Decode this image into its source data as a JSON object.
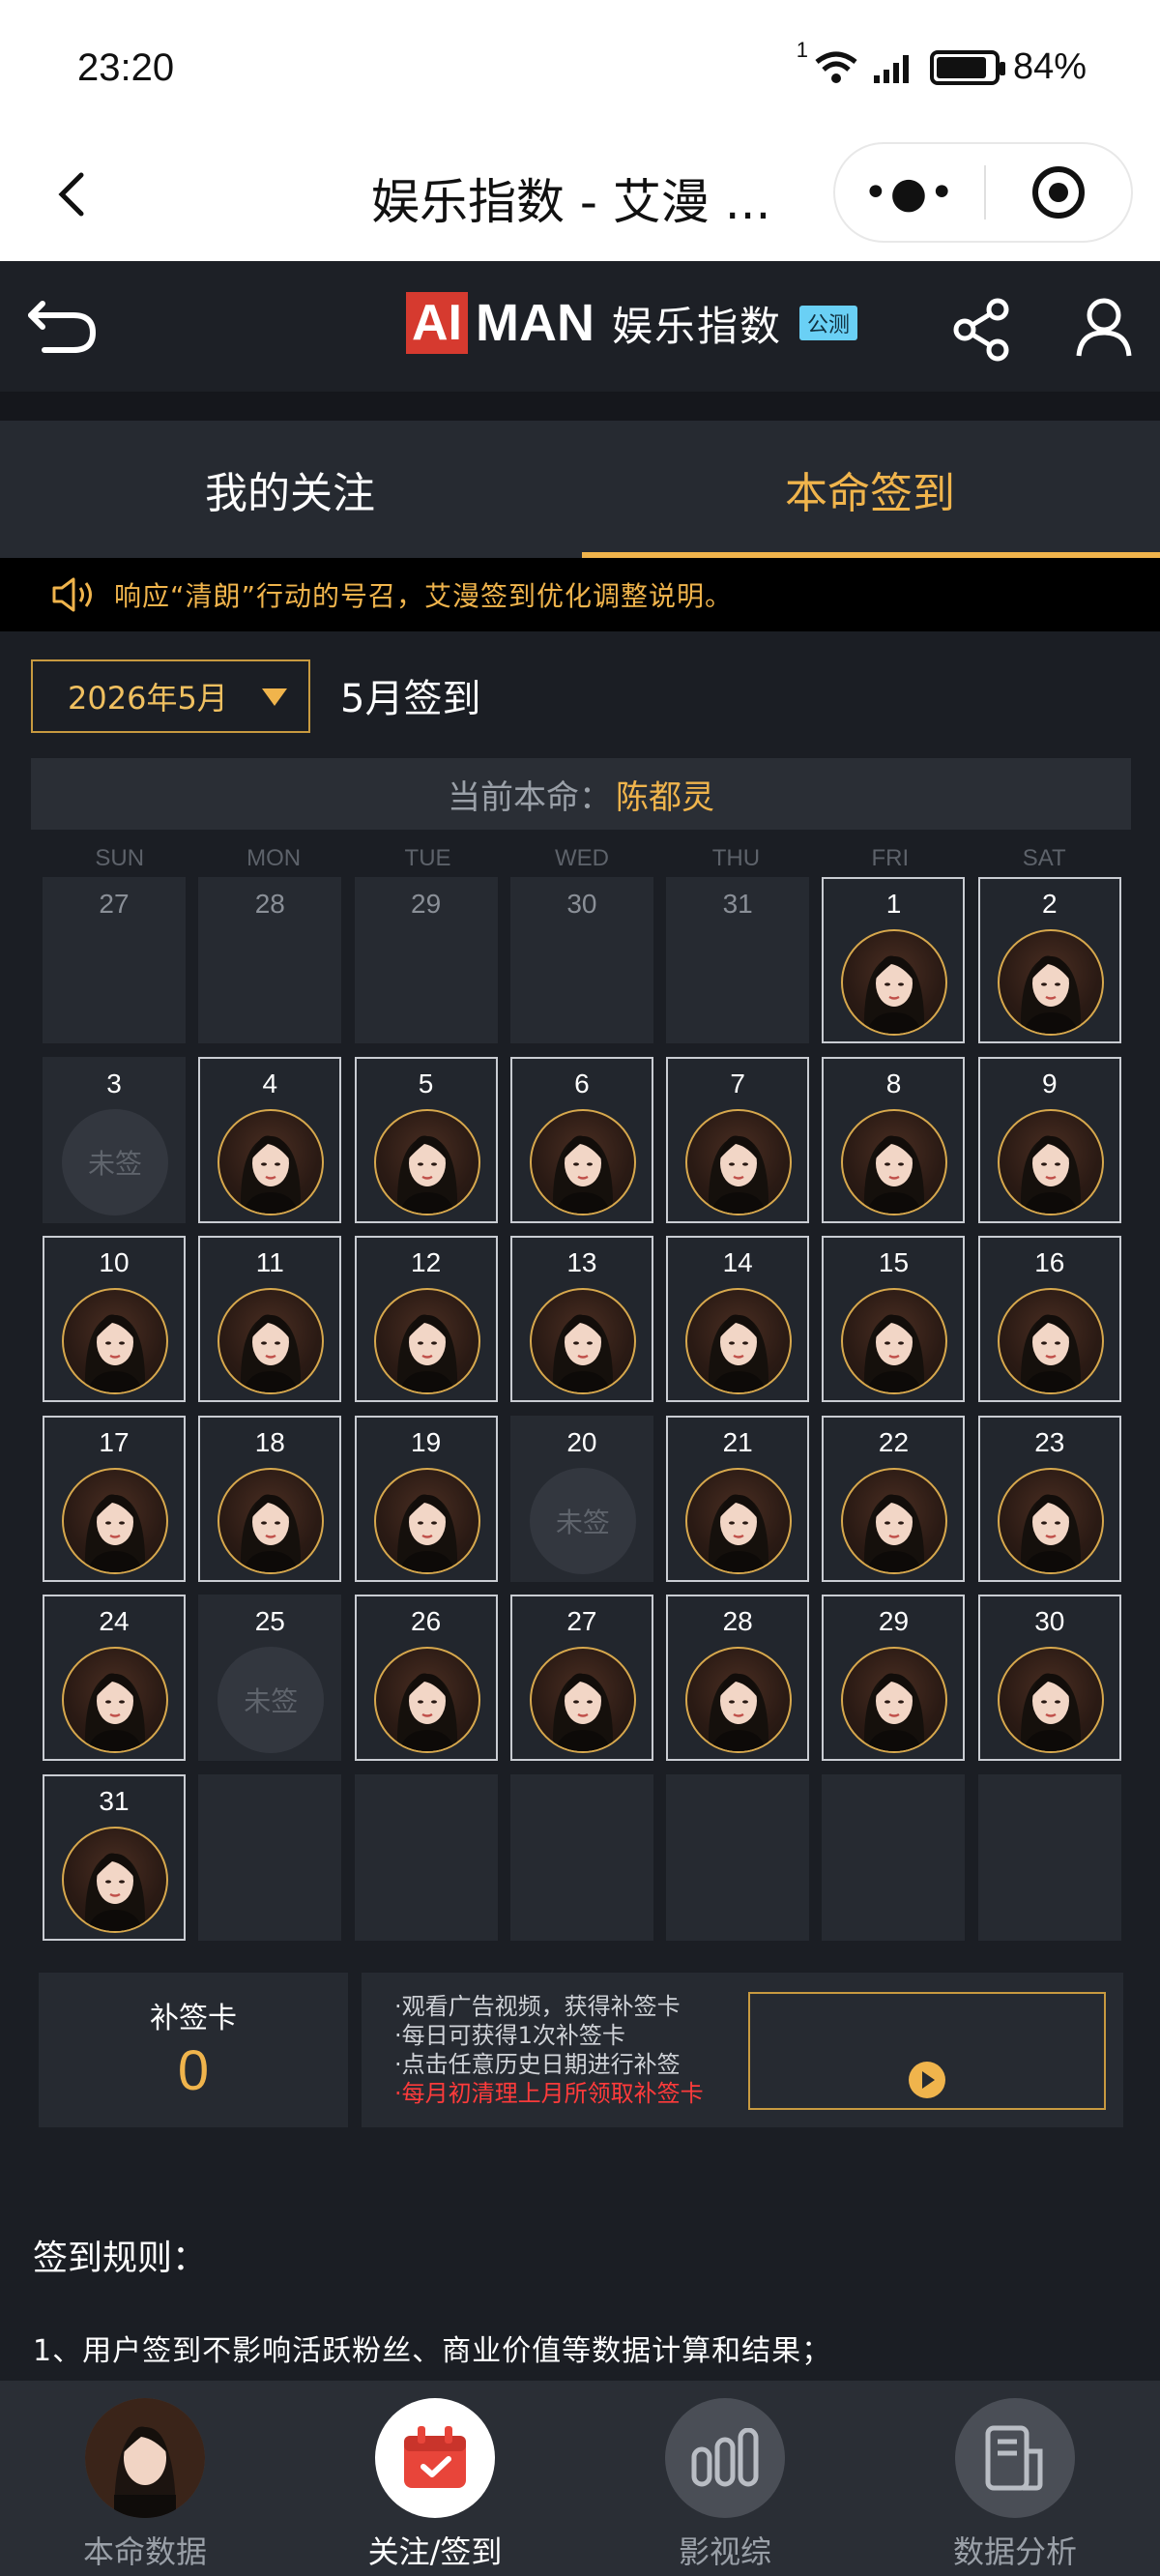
{
  "status_bar": {
    "time": "23:20",
    "wifi_badge": "1",
    "battery": "84%"
  },
  "title_bar": {
    "title": "娱乐指数 - 艾漫 ..."
  },
  "app_header": {
    "brand_ai": "AI",
    "brand_man": "MAN",
    "brand_cn": "娱乐指数",
    "brand_badge": "公测"
  },
  "tabs": [
    {
      "label": "我的关注",
      "active": false
    },
    {
      "label": "本命签到",
      "active": true
    }
  ],
  "notice": {
    "text": "响应“清朗”行动的号召，艾漫签到优化调整说明。"
  },
  "month_selector": {
    "value": "2026年5月",
    "title": "5月签到"
  },
  "current_idol": {
    "label": "当前本命：",
    "name": "陈都灵"
  },
  "weekdays": [
    "SUN",
    "MON",
    "TUE",
    "WED",
    "THU",
    "FRI",
    "SAT"
  ],
  "calendar_cells": [
    {
      "day": "27",
      "status": "other"
    },
    {
      "day": "28",
      "status": "other"
    },
    {
      "day": "29",
      "status": "other"
    },
    {
      "day": "30",
      "status": "other"
    },
    {
      "day": "31",
      "status": "other"
    },
    {
      "day": "1",
      "status": "signed"
    },
    {
      "day": "2",
      "status": "signed"
    },
    {
      "day": "3",
      "status": "unsigned"
    },
    {
      "day": "4",
      "status": "signed"
    },
    {
      "day": "5",
      "status": "signed"
    },
    {
      "day": "6",
      "status": "signed"
    },
    {
      "day": "7",
      "status": "signed"
    },
    {
      "day": "8",
      "status": "signed"
    },
    {
      "day": "9",
      "status": "signed"
    },
    {
      "day": "10",
      "status": "signed"
    },
    {
      "day": "11",
      "status": "signed"
    },
    {
      "day": "12",
      "status": "signed"
    },
    {
      "day": "13",
      "status": "signed"
    },
    {
      "day": "14",
      "status": "signed"
    },
    {
      "day": "15",
      "status": "signed"
    },
    {
      "day": "16",
      "status": "signed"
    },
    {
      "day": "17",
      "status": "signed"
    },
    {
      "day": "18",
      "status": "signed"
    },
    {
      "day": "19",
      "status": "signed"
    },
    {
      "day": "20",
      "status": "unsigned"
    },
    {
      "day": "21",
      "status": "signed"
    },
    {
      "day": "22",
      "status": "signed"
    },
    {
      "day": "23",
      "status": "signed"
    },
    {
      "day": "24",
      "status": "signed"
    },
    {
      "day": "25",
      "status": "unsigned"
    },
    {
      "day": "26",
      "status": "signed"
    },
    {
      "day": "27",
      "status": "signed"
    },
    {
      "day": "28",
      "status": "signed"
    },
    {
      "day": "29",
      "status": "signed"
    },
    {
      "day": "30",
      "status": "signed"
    },
    {
      "day": "31",
      "status": "signed"
    },
    {
      "day": "",
      "status": "empty"
    },
    {
      "day": "",
      "status": "empty"
    },
    {
      "day": "",
      "status": "empty"
    },
    {
      "day": "",
      "status": "empty"
    },
    {
      "day": "",
      "status": "empty"
    },
    {
      "day": "",
      "status": "empty"
    }
  ],
  "unsigned_label": "未签",
  "makeup_card": {
    "label": "补签卡",
    "count": "0"
  },
  "tips": [
    {
      "text": "·观看广告视频，获得补签卡",
      "warn": false
    },
    {
      "text": "·每日可获得1次补签卡",
      "warn": false
    },
    {
      "text": "·点击任意历史日期进行补签",
      "warn": false
    },
    {
      "text": "·每月初清理上月所领取补签卡",
      "warn": true
    }
  ],
  "rules": {
    "title": "签到规则：",
    "item1": "1、用户签到不影响活跃粉丝、商业价值等数据计算和结果；"
  },
  "bottom_nav": [
    {
      "label": "本命数据",
      "icon": "avatar",
      "active": false
    },
    {
      "label": "关注/签到",
      "icon": "calendar-icon",
      "active": true
    },
    {
      "label": "影视综",
      "icon": "bar-chart-icon",
      "active": false
    },
    {
      "label": "数据分析",
      "icon": "document-icon",
      "active": false
    }
  ],
  "colors": {
    "accent": "#f0b44c",
    "background": "#1b1e24",
    "warn": "#ff3b3b",
    "brand_red": "#d63a2f"
  }
}
